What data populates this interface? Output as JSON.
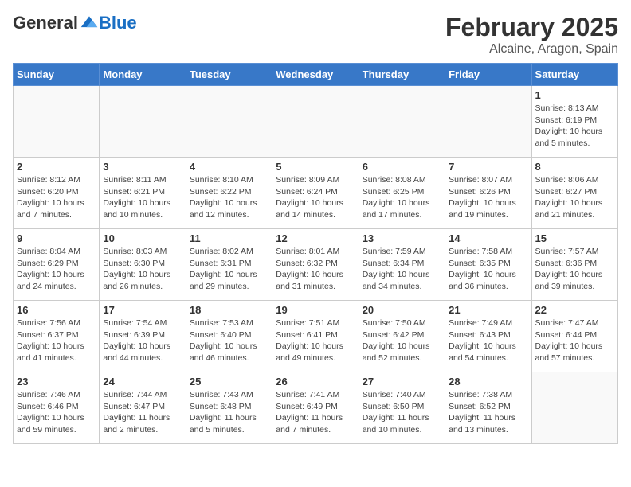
{
  "header": {
    "logo_general": "General",
    "logo_blue": "Blue",
    "month_title": "February 2025",
    "location": "Alcaine, Aragon, Spain"
  },
  "days_of_week": [
    "Sunday",
    "Monday",
    "Tuesday",
    "Wednesday",
    "Thursday",
    "Friday",
    "Saturday"
  ],
  "weeks": [
    [
      {
        "day": "",
        "info": ""
      },
      {
        "day": "",
        "info": ""
      },
      {
        "day": "",
        "info": ""
      },
      {
        "day": "",
        "info": ""
      },
      {
        "day": "",
        "info": ""
      },
      {
        "day": "",
        "info": ""
      },
      {
        "day": "1",
        "info": "Sunrise: 8:13 AM\nSunset: 6:19 PM\nDaylight: 10 hours and 5 minutes."
      }
    ],
    [
      {
        "day": "2",
        "info": "Sunrise: 8:12 AM\nSunset: 6:20 PM\nDaylight: 10 hours and 7 minutes."
      },
      {
        "day": "3",
        "info": "Sunrise: 8:11 AM\nSunset: 6:21 PM\nDaylight: 10 hours and 10 minutes."
      },
      {
        "day": "4",
        "info": "Sunrise: 8:10 AM\nSunset: 6:22 PM\nDaylight: 10 hours and 12 minutes."
      },
      {
        "day": "5",
        "info": "Sunrise: 8:09 AM\nSunset: 6:24 PM\nDaylight: 10 hours and 14 minutes."
      },
      {
        "day": "6",
        "info": "Sunrise: 8:08 AM\nSunset: 6:25 PM\nDaylight: 10 hours and 17 minutes."
      },
      {
        "day": "7",
        "info": "Sunrise: 8:07 AM\nSunset: 6:26 PM\nDaylight: 10 hours and 19 minutes."
      },
      {
        "day": "8",
        "info": "Sunrise: 8:06 AM\nSunset: 6:27 PM\nDaylight: 10 hours and 21 minutes."
      }
    ],
    [
      {
        "day": "9",
        "info": "Sunrise: 8:04 AM\nSunset: 6:29 PM\nDaylight: 10 hours and 24 minutes."
      },
      {
        "day": "10",
        "info": "Sunrise: 8:03 AM\nSunset: 6:30 PM\nDaylight: 10 hours and 26 minutes."
      },
      {
        "day": "11",
        "info": "Sunrise: 8:02 AM\nSunset: 6:31 PM\nDaylight: 10 hours and 29 minutes."
      },
      {
        "day": "12",
        "info": "Sunrise: 8:01 AM\nSunset: 6:32 PM\nDaylight: 10 hours and 31 minutes."
      },
      {
        "day": "13",
        "info": "Sunrise: 7:59 AM\nSunset: 6:34 PM\nDaylight: 10 hours and 34 minutes."
      },
      {
        "day": "14",
        "info": "Sunrise: 7:58 AM\nSunset: 6:35 PM\nDaylight: 10 hours and 36 minutes."
      },
      {
        "day": "15",
        "info": "Sunrise: 7:57 AM\nSunset: 6:36 PM\nDaylight: 10 hours and 39 minutes."
      }
    ],
    [
      {
        "day": "16",
        "info": "Sunrise: 7:56 AM\nSunset: 6:37 PM\nDaylight: 10 hours and 41 minutes."
      },
      {
        "day": "17",
        "info": "Sunrise: 7:54 AM\nSunset: 6:39 PM\nDaylight: 10 hours and 44 minutes."
      },
      {
        "day": "18",
        "info": "Sunrise: 7:53 AM\nSunset: 6:40 PM\nDaylight: 10 hours and 46 minutes."
      },
      {
        "day": "19",
        "info": "Sunrise: 7:51 AM\nSunset: 6:41 PM\nDaylight: 10 hours and 49 minutes."
      },
      {
        "day": "20",
        "info": "Sunrise: 7:50 AM\nSunset: 6:42 PM\nDaylight: 10 hours and 52 minutes."
      },
      {
        "day": "21",
        "info": "Sunrise: 7:49 AM\nSunset: 6:43 PM\nDaylight: 10 hours and 54 minutes."
      },
      {
        "day": "22",
        "info": "Sunrise: 7:47 AM\nSunset: 6:44 PM\nDaylight: 10 hours and 57 minutes."
      }
    ],
    [
      {
        "day": "23",
        "info": "Sunrise: 7:46 AM\nSunset: 6:46 PM\nDaylight: 10 hours and 59 minutes."
      },
      {
        "day": "24",
        "info": "Sunrise: 7:44 AM\nSunset: 6:47 PM\nDaylight: 11 hours and 2 minutes."
      },
      {
        "day": "25",
        "info": "Sunrise: 7:43 AM\nSunset: 6:48 PM\nDaylight: 11 hours and 5 minutes."
      },
      {
        "day": "26",
        "info": "Sunrise: 7:41 AM\nSunset: 6:49 PM\nDaylight: 11 hours and 7 minutes."
      },
      {
        "day": "27",
        "info": "Sunrise: 7:40 AM\nSunset: 6:50 PM\nDaylight: 11 hours and 10 minutes."
      },
      {
        "day": "28",
        "info": "Sunrise: 7:38 AM\nSunset: 6:52 PM\nDaylight: 11 hours and 13 minutes."
      },
      {
        "day": "",
        "info": ""
      }
    ]
  ]
}
